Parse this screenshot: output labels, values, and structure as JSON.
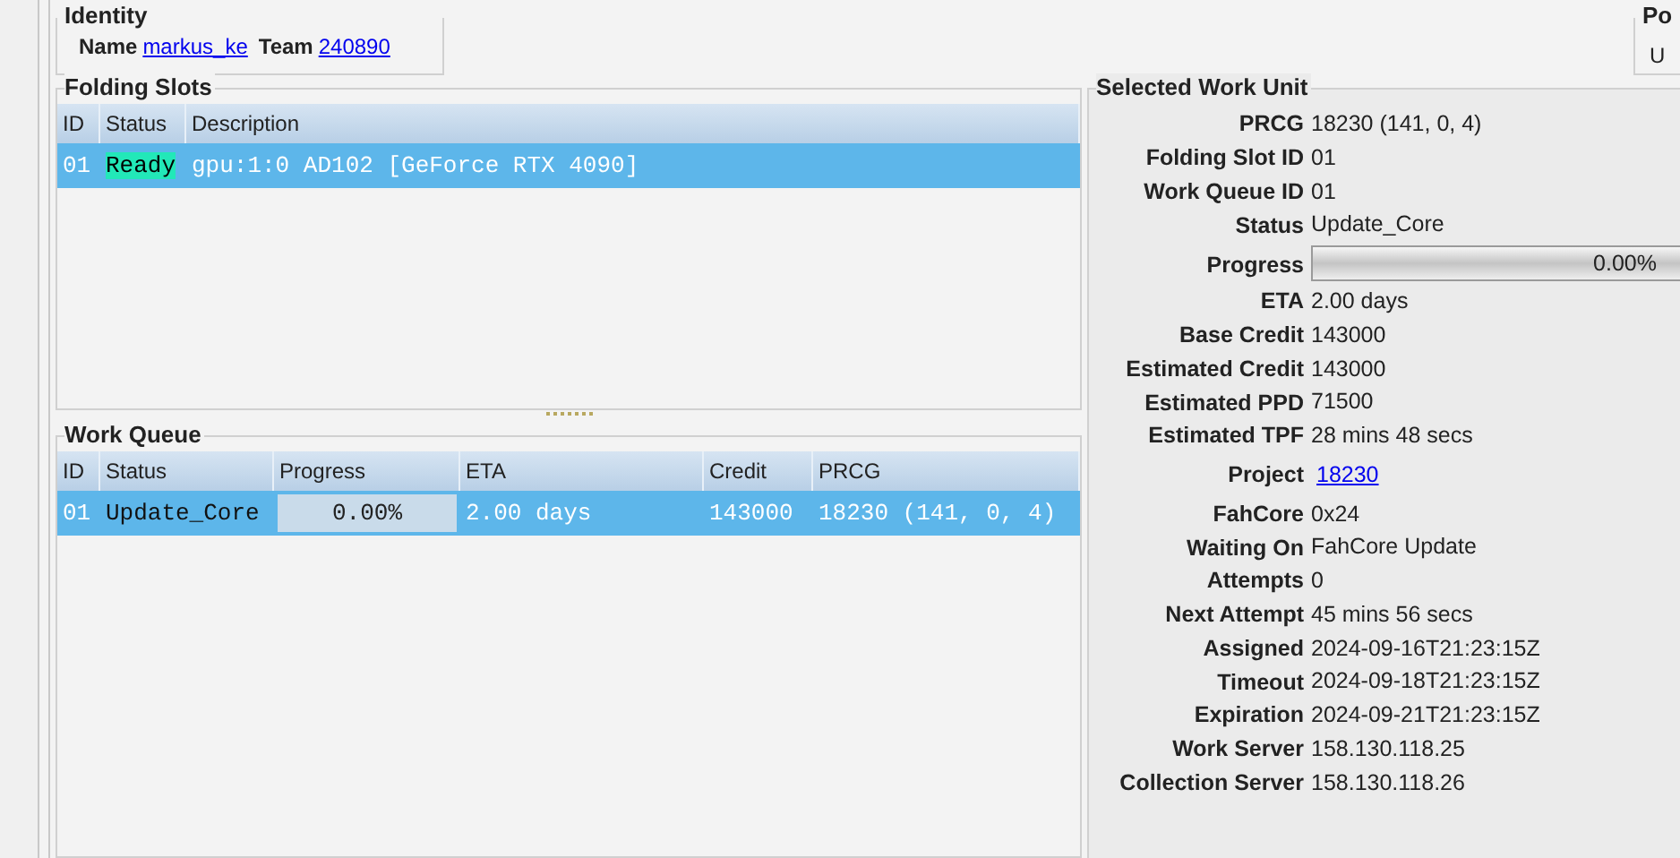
{
  "identity": {
    "title": "Identity",
    "name_label": "Name",
    "name": "markus_ke",
    "team_label": "Team",
    "team": "240890"
  },
  "cut_panel": {
    "title": "Po",
    "text": "U"
  },
  "folding_slots": {
    "title": "Folding Slots",
    "columns": [
      "ID",
      "Status",
      "Description"
    ],
    "rows": [
      {
        "id": "01",
        "status": "Ready",
        "description": "gpu:1:0 AD102 [GeForce RTX 4090]",
        "selected": true
      }
    ]
  },
  "work_queue": {
    "title": "Work Queue",
    "columns": [
      "ID",
      "Status",
      "Progress",
      "ETA",
      "Credit",
      "PRCG"
    ],
    "rows": [
      {
        "id": "01",
        "status": "Update_Core",
        "progress": "0.00%",
        "level": 0,
        "eta": "2.00 days",
        "credit": "143000",
        "prcg": "18230 (141, 0, 4)",
        "selected": true
      }
    ]
  },
  "selected_work_unit": {
    "title": "Selected Work Unit",
    "fields": [
      {
        "kind": "text",
        "label": "PRCG",
        "value": "18230 (141, 0, 4)"
      },
      {
        "kind": "text",
        "label": "Folding Slot ID",
        "value": "01"
      },
      {
        "kind": "text",
        "label": "Work Queue ID",
        "value": "01"
      },
      {
        "kind": "text",
        "label": "Status",
        "value": "Update_Core"
      },
      {
        "kind": "progress",
        "label": "Progress",
        "value": "0.00%",
        "level": 0
      },
      {
        "kind": "text",
        "label": "ETA",
        "value": "2.00 days"
      },
      {
        "kind": "text",
        "label": "Base Credit",
        "value": "143000"
      },
      {
        "kind": "text",
        "label": "Estimated Credit",
        "value": "143000"
      },
      {
        "kind": "text",
        "label": "Estimated PPD",
        "value": "71500"
      },
      {
        "kind": "text",
        "label": "Estimated TPF",
        "value": "28 mins 48 secs"
      },
      {
        "kind": "link",
        "label": "Project",
        "value": "18230"
      },
      {
        "kind": "text",
        "label": "FahCore",
        "value": "0x24"
      },
      {
        "kind": "text",
        "label": "Waiting On",
        "value": "FahCore Update"
      },
      {
        "kind": "text",
        "label": "Attempts",
        "value": "0"
      },
      {
        "kind": "text",
        "label": "Next Attempt",
        "value": "45 mins 56 secs"
      },
      {
        "kind": "text",
        "label": "Assigned",
        "value": "2024-09-16T21:23:15Z"
      },
      {
        "kind": "text",
        "label": "Timeout",
        "value": "2024-09-18T21:23:15Z"
      },
      {
        "kind": "text",
        "label": "Expiration",
        "value": "2024-09-21T21:23:15Z"
      },
      {
        "kind": "text",
        "label": "Work Server",
        "value": "158.130.118.25"
      },
      {
        "kind": "text",
        "label": "Collection Server",
        "value": "158.130.118.26"
      }
    ]
  }
}
